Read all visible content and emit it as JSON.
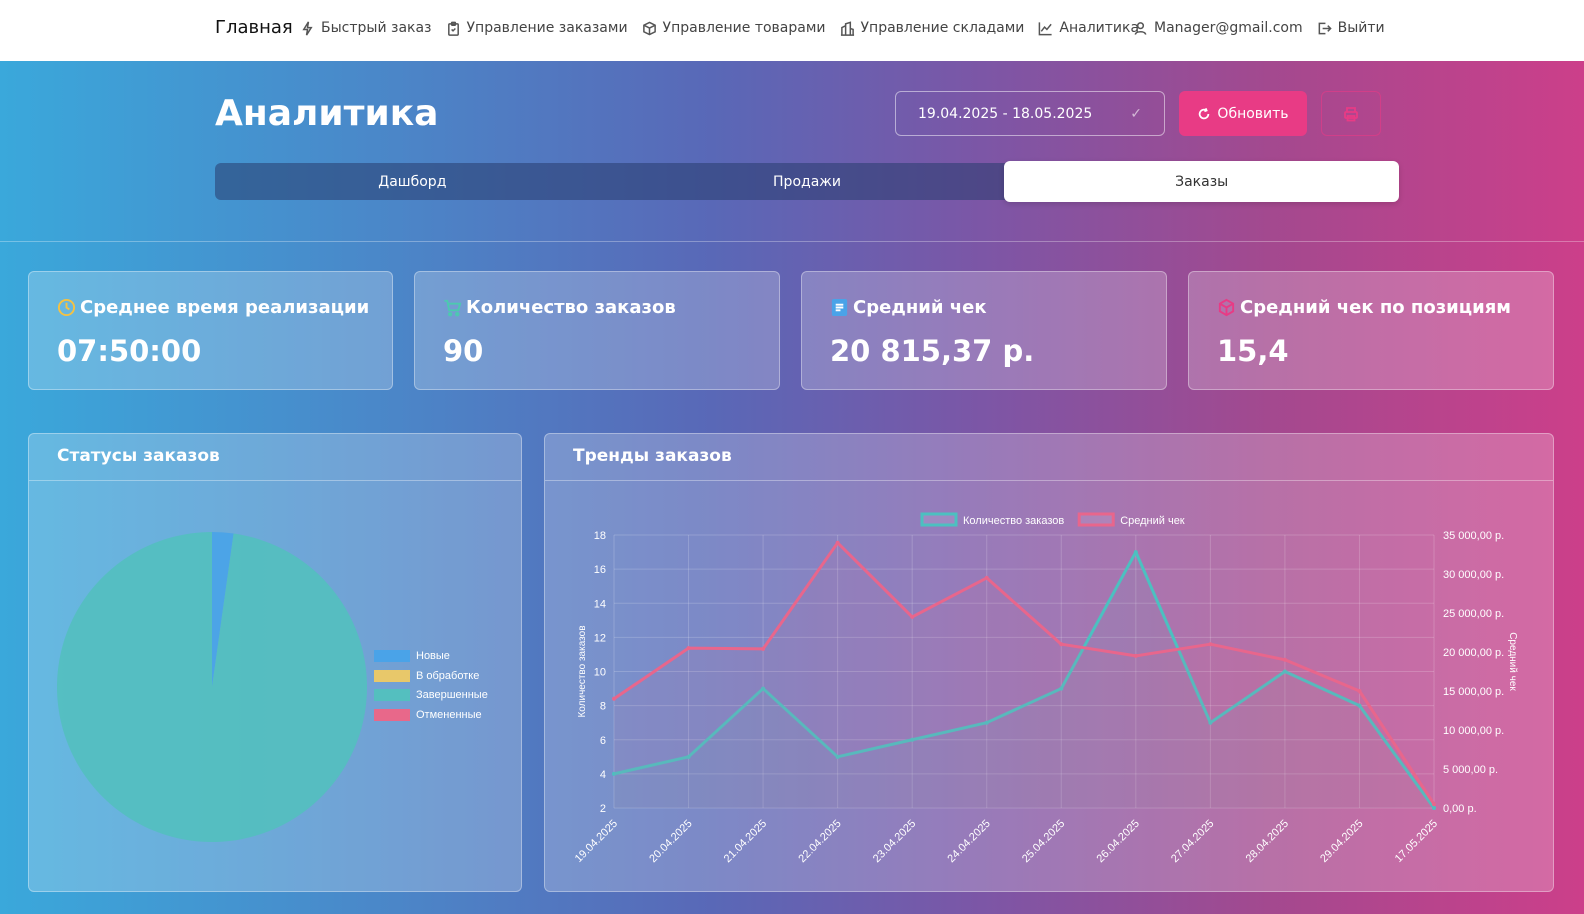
{
  "nav": {
    "brand": "Главная",
    "items": [
      {
        "label": "Быстрый заказ",
        "icon": "bolt-icon"
      },
      {
        "label": "Управление заказами",
        "icon": "clipboard-icon"
      },
      {
        "label": "Управление товарами",
        "icon": "box-icon"
      },
      {
        "label": "Управление складами",
        "icon": "building-icon"
      },
      {
        "label": "Аналитика",
        "icon": "chart-line-icon"
      }
    ],
    "user": "Manager@gmail.com",
    "logout": "Выйти"
  },
  "header": {
    "title": "Аналитика",
    "date_range": "19.04.2025 - 18.05.2025",
    "refresh_label": "Обновить"
  },
  "tabs": [
    {
      "label": "Дашборд",
      "active": false
    },
    {
      "label": "Продажи",
      "active": false
    },
    {
      "label": "Заказы",
      "active": true
    }
  ],
  "kpis": [
    {
      "title": "Среднее время реализации",
      "value": "07:50:00",
      "icon": "clock-icon",
      "color": "#f5c242"
    },
    {
      "title": "Количество заказов",
      "value": "90",
      "icon": "cart-icon",
      "color": "#4cc9b0"
    },
    {
      "title": "Средний чек",
      "value": "20 815,37 р.",
      "icon": "receipt-icon",
      "color": "#4aa3e8"
    },
    {
      "title": "Средний чек по позициям",
      "value": "15,4",
      "icon": "cube-icon",
      "color": "#e83b85"
    }
  ],
  "panels": {
    "status_title": "Статусы заказов",
    "trend_title": "Тренды заказов"
  },
  "chart_data": [
    {
      "type": "pie",
      "title": "Статусы заказов",
      "labels": [
        "Новые",
        "В обработке",
        "Завершенные",
        "Отмененные"
      ],
      "values": [
        2,
        0,
        88,
        0
      ],
      "colors": [
        "#4aa3e8",
        "#e8c86a",
        "#54bfbf",
        "#e8688a"
      ],
      "legend_position": "right"
    },
    {
      "type": "line",
      "title": "Тренды заказов",
      "x": [
        "19.04.2025",
        "20.04.2025",
        "21.04.2025",
        "22.04.2025",
        "23.04.2025",
        "24.04.2025",
        "25.04.2025",
        "26.04.2025",
        "27.04.2025",
        "28.04.2025",
        "29.04.2025",
        "17.05.2025"
      ],
      "series": [
        {
          "name": "Количество заказов",
          "axis": "left",
          "color": "#4cc0c0",
          "values": [
            4,
            5,
            9,
            5,
            6,
            7,
            9,
            17,
            7,
            10,
            8,
            2
          ]
        },
        {
          "name": "Средний чек",
          "axis": "right",
          "color": "#e8668c",
          "values": [
            14000,
            20500,
            20400,
            34000,
            24500,
            29500,
            21000,
            19500,
            21000,
            19000,
            15000,
            500
          ]
        }
      ],
      "ylabel_left": "Количество заказов",
      "ylabel_right": "Средний чек",
      "ylim_left": [
        2,
        18
      ],
      "yticks_left": [
        "2",
        "4",
        "6",
        "8",
        "10",
        "12",
        "14",
        "16",
        "18"
      ],
      "ylim_right": [
        0,
        35000
      ],
      "yticks_right": [
        "0,00 р.",
        "5 000,00 р.",
        "10 000,00 р.",
        "15 000,00 р.",
        "20 000,00 р.",
        "25 000,00 р.",
        "30 000,00 р.",
        "35 000,00 р."
      ],
      "grid": true,
      "legend_position": "top"
    }
  ]
}
